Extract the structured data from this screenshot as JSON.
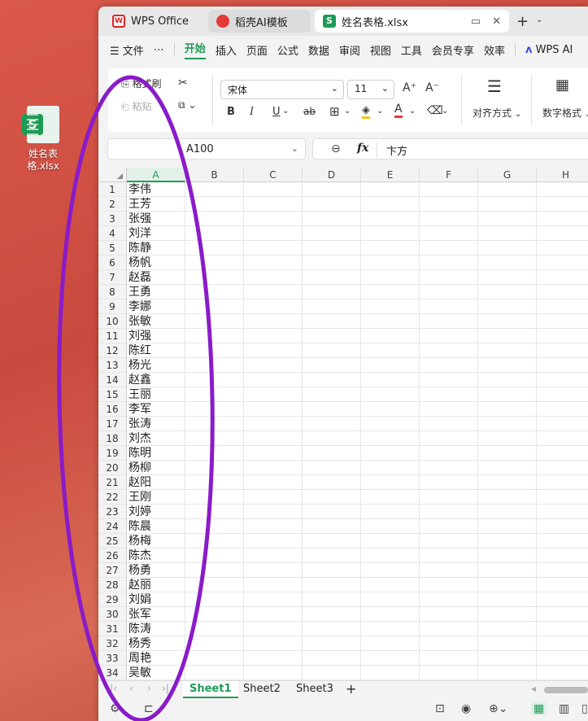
{
  "desktop": {
    "icon_label": "姓名表格.xlsx",
    "icon_letter": "S"
  },
  "tabs": [
    {
      "label": "WPS Office",
      "logo": "W"
    },
    {
      "label": "稻壳AI模板",
      "logo": ""
    },
    {
      "label": "姓名表格.xlsx",
      "logo": "S"
    }
  ],
  "tab_icons": {
    "monitor": "▭",
    "close": "✕",
    "new": "+",
    "caret": "⌄"
  },
  "menu": {
    "file": "☰ 文件",
    "more": "⋯",
    "items": [
      "开始",
      "插入",
      "页面",
      "公式",
      "数据",
      "审阅",
      "视图",
      "工具",
      "会员专享",
      "效率"
    ],
    "ai": "WPS AI"
  },
  "ribbon": {
    "format_painter": "格式刷",
    "paste": "粘贴",
    "font_name": "宋体",
    "font_size": "11",
    "bold": "B",
    "italic": "I",
    "underline": "U",
    "strike": "ab",
    "align": "对齐方式",
    "number_format": "数字格式"
  },
  "formula_bar": {
    "cell_ref": "A100",
    "fx": "fx",
    "value": "卞方"
  },
  "columns": [
    "A",
    "B",
    "C",
    "D",
    "E",
    "F",
    "G",
    "H"
  ],
  "rows": [
    "李伟",
    "王芳",
    "张强",
    "刘洋",
    "陈静",
    "杨帆",
    "赵磊",
    "王勇",
    "李娜",
    "张敏",
    "刘强",
    "陈红",
    "杨光",
    "赵鑫",
    "王丽",
    "李军",
    "张涛",
    "刘杰",
    "陈明",
    "杨柳",
    "赵阳",
    "王刚",
    "刘婷",
    "陈晨",
    "杨梅",
    "陈杰",
    "杨勇",
    "赵丽",
    "刘娟",
    "张军",
    "陈涛",
    "杨秀",
    "周艳",
    "吴敏"
  ],
  "sheets": [
    "Sheet1",
    "Sheet2",
    "Sheet3"
  ],
  "colors": {
    "accent": "#1e9b55",
    "annotation": "#8a1bc9",
    "desktop": "#d9584a"
  }
}
